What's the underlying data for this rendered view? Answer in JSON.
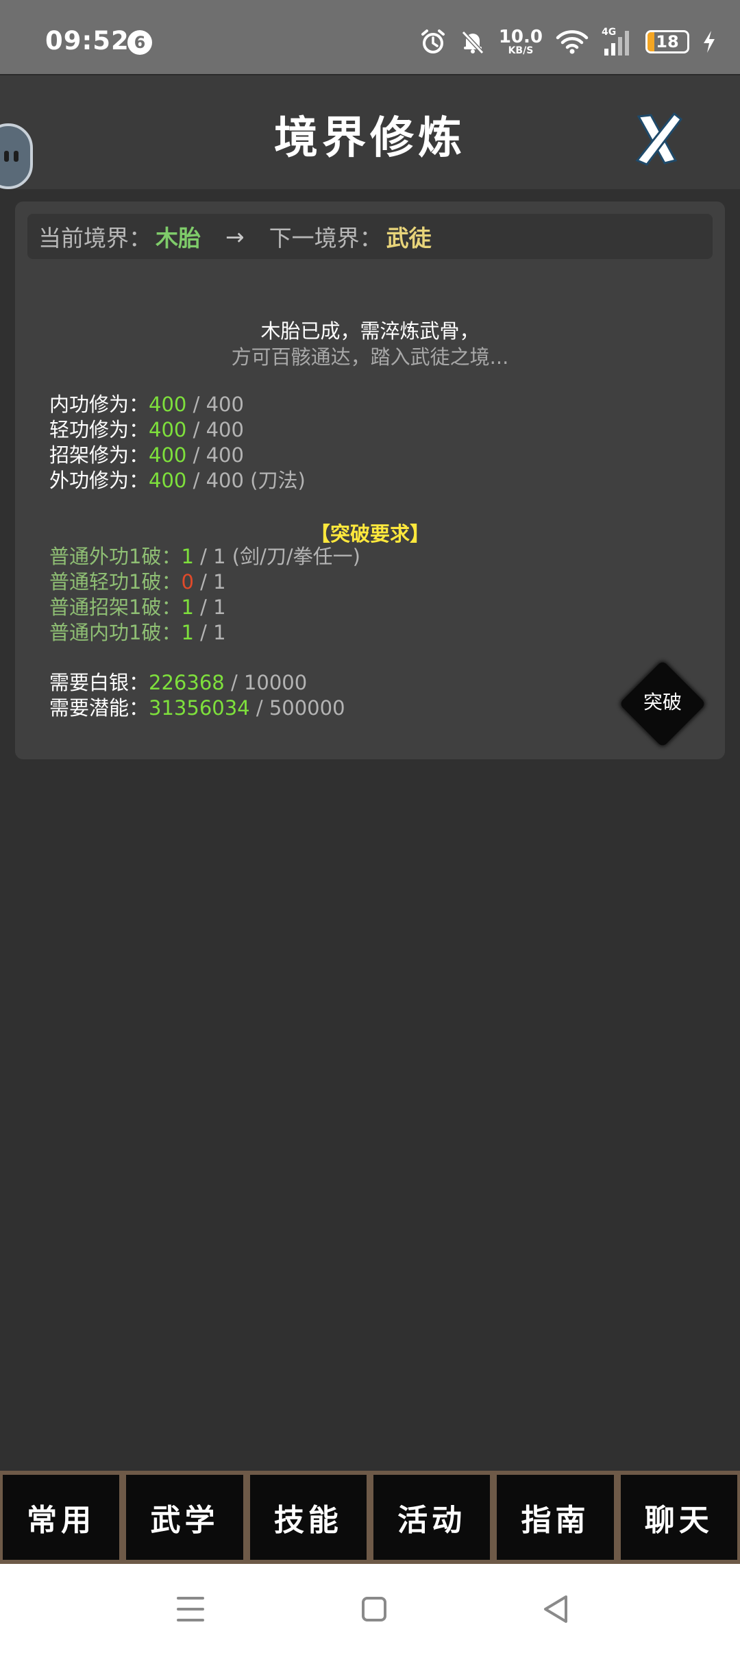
{
  "status_bar": {
    "time": "09:52",
    "notification_count": "6",
    "net_speed": "10.0",
    "net_unit": "KB/S",
    "signal_type": "4G",
    "battery_level": "18",
    "battery_fraction": 0.18,
    "battery_color": "#f5a623",
    "icons": [
      "alarm-icon",
      "bell-off-icon",
      "wifi-icon",
      "signal-icon",
      "battery-icon",
      "charging-icon"
    ]
  },
  "header": {
    "title": "境界修炼",
    "close_icon": "close-icon"
  },
  "realm": {
    "current_label": "当前境界：",
    "current_value": "木胎",
    "arrow": "→",
    "next_label": "下一境界：",
    "next_value": "武徒"
  },
  "description": {
    "line1": "木胎已成，需淬炼武骨，",
    "line2": "方可百骸通达，踏入武徒之境..."
  },
  "cultivation": [
    {
      "label": "内功修为：",
      "current": "400",
      "required": " / 400",
      "note": ""
    },
    {
      "label": "轻功修为：",
      "current": "400",
      "required": " / 400",
      "note": ""
    },
    {
      "label": "招架修为：",
      "current": "400",
      "required": " / 400",
      "note": ""
    },
    {
      "label": "外功修为：",
      "current": "400",
      "required": " / 400",
      "note": " (刀法)"
    }
  ],
  "requirements": {
    "heading": "【突破要求】",
    "items": [
      {
        "label": "普通外功1破：",
        "current": "1",
        "required": " / 1",
        "note": " (剑/刀/拳任一)"
      },
      {
        "label": "普通轻功1破：",
        "current": "0",
        "required": " / 1",
        "note": ""
      },
      {
        "label": "普通招架1破：",
        "current": "1",
        "required": " / 1",
        "note": ""
      },
      {
        "label": "普通内功1破：",
        "current": "1",
        "required": " / 1",
        "note": ""
      }
    ]
  },
  "costs": [
    {
      "label": "需要白银：",
      "current": "226368",
      "required": " / 10000"
    },
    {
      "label": "需要潜能：",
      "current": "31356034",
      "required": " / 500000"
    }
  ],
  "breakthrough_button": {
    "label": "突破"
  },
  "bottom_nav": [
    {
      "label": "常用"
    },
    {
      "label": "武学"
    },
    {
      "label": "技能"
    },
    {
      "label": "活动"
    },
    {
      "label": "指南"
    },
    {
      "label": "聊天"
    }
  ],
  "system_nav": [
    "menu-icon",
    "home-icon",
    "back-icon"
  ],
  "colors": {
    "ok": "#7ee03c",
    "fail": "#e04a2a",
    "heading": "#ffe83c",
    "current_realm": "#7fcc6a",
    "next_realm": "#e8d47a"
  }
}
